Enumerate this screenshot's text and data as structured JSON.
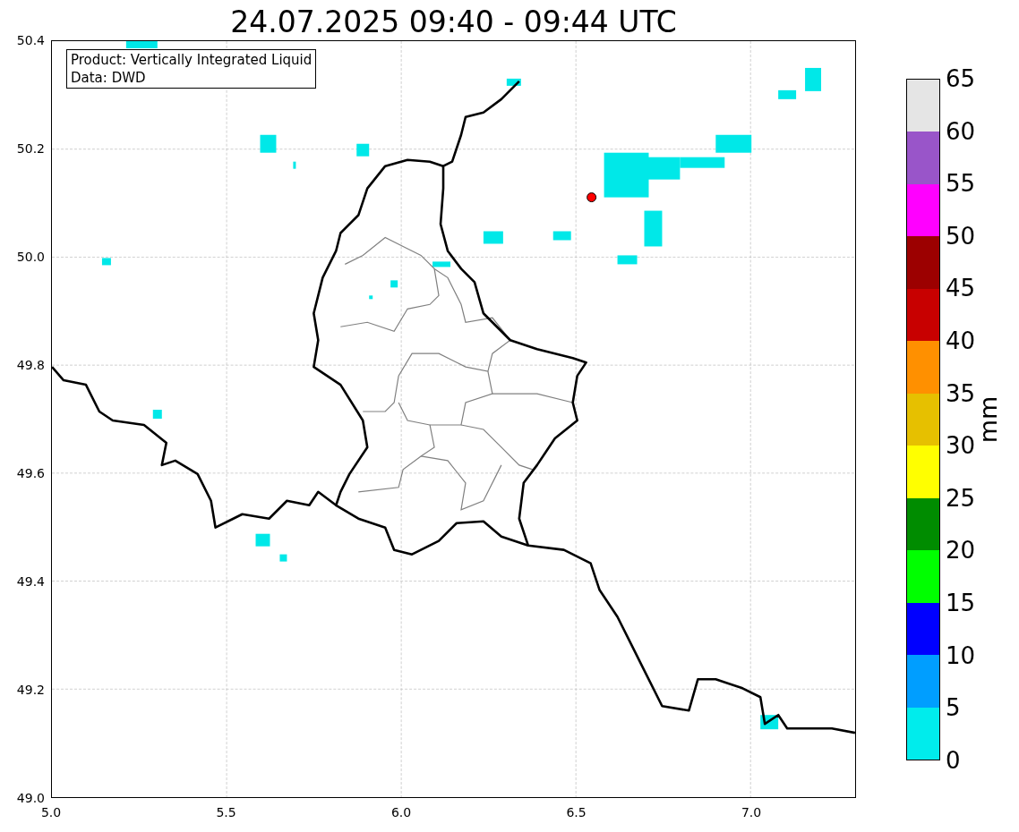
{
  "title": "24.07.2025 09:40 - 09:44 UTC",
  "info_box": [
    "Product: Vertically Integrated Liquid",
    "Data: DWD"
  ],
  "y_ticks": [
    "50.4",
    "50.2",
    "50.0",
    "49.8",
    "49.6",
    "49.4",
    "49.2",
    "49.0"
  ],
  "x_ticks": [
    "5.0",
    "5.5",
    "6.0",
    "6.5",
    "7.0"
  ],
  "colorbar": {
    "label": "mm",
    "ticks": [
      "65",
      "60",
      "55",
      "50",
      "45",
      "40",
      "35",
      "30",
      "25",
      "20",
      "15",
      "10",
      "5",
      "0"
    ],
    "bands": [
      {
        "color": "#e5e5e5"
      },
      {
        "color": "#9955c9"
      },
      {
        "color": "#ff00ff"
      },
      {
        "color": "#9c0000"
      },
      {
        "color": "#c80000"
      },
      {
        "color": "#ff9000"
      },
      {
        "color": "#e6c000"
      },
      {
        "color": "#ffff00"
      },
      {
        "color": "#008c00"
      },
      {
        "color": "#00ff00"
      },
      {
        "color": "#0000ff"
      },
      {
        "color": "#009eff"
      },
      {
        "color": "#00ecec"
      }
    ]
  }
}
